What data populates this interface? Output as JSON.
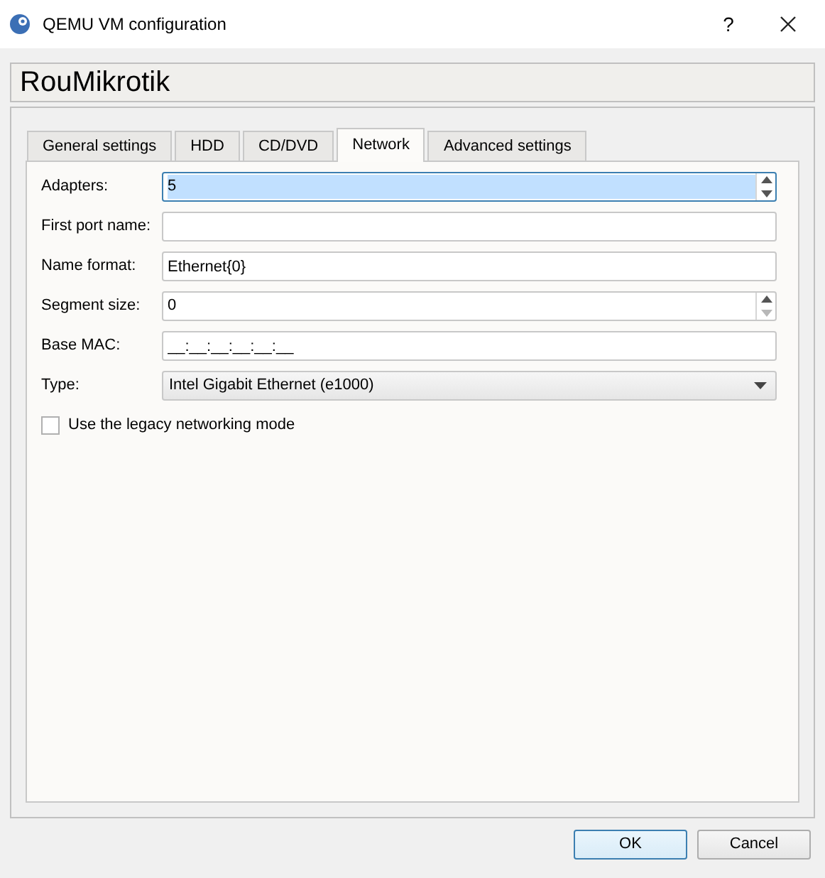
{
  "window": {
    "title": "QEMU VM configuration",
    "help": "?"
  },
  "vm_name": "RouMikrotik",
  "tabs": [
    {
      "label": "General settings",
      "selected": false
    },
    {
      "label": "HDD",
      "selected": false
    },
    {
      "label": "CD/DVD",
      "selected": false
    },
    {
      "label": "Network",
      "selected": true
    },
    {
      "label": "Advanced settings",
      "selected": false
    }
  ],
  "fields": [
    {
      "label": "Adapters:",
      "kind": "spin",
      "value": "5",
      "focused": true,
      "down_disabled": false
    },
    {
      "label": "First port name:",
      "kind": "text",
      "focused": false
    },
    {
      "label": "Name format:",
      "kind": "text",
      "value": "Ethernet{0}",
      "focused": false
    },
    {
      "label": "Segment size:",
      "kind": "spin",
      "value": "0",
      "focused": false,
      "down_disabled": true
    },
    {
      "label": "Base MAC:",
      "kind": "text",
      "value": "__:__:__:__:__:__",
      "focused": false
    },
    {
      "label": "Type:",
      "kind": "combo",
      "value": "Intel Gigabit Ethernet (e1000)"
    }
  ],
  "legacy_mode": {
    "label": "Use the legacy networking mode",
    "checked": false
  },
  "buttons": [
    {
      "label": "OK",
      "default": true
    },
    {
      "label": "Cancel",
      "default": false
    }
  ]
}
